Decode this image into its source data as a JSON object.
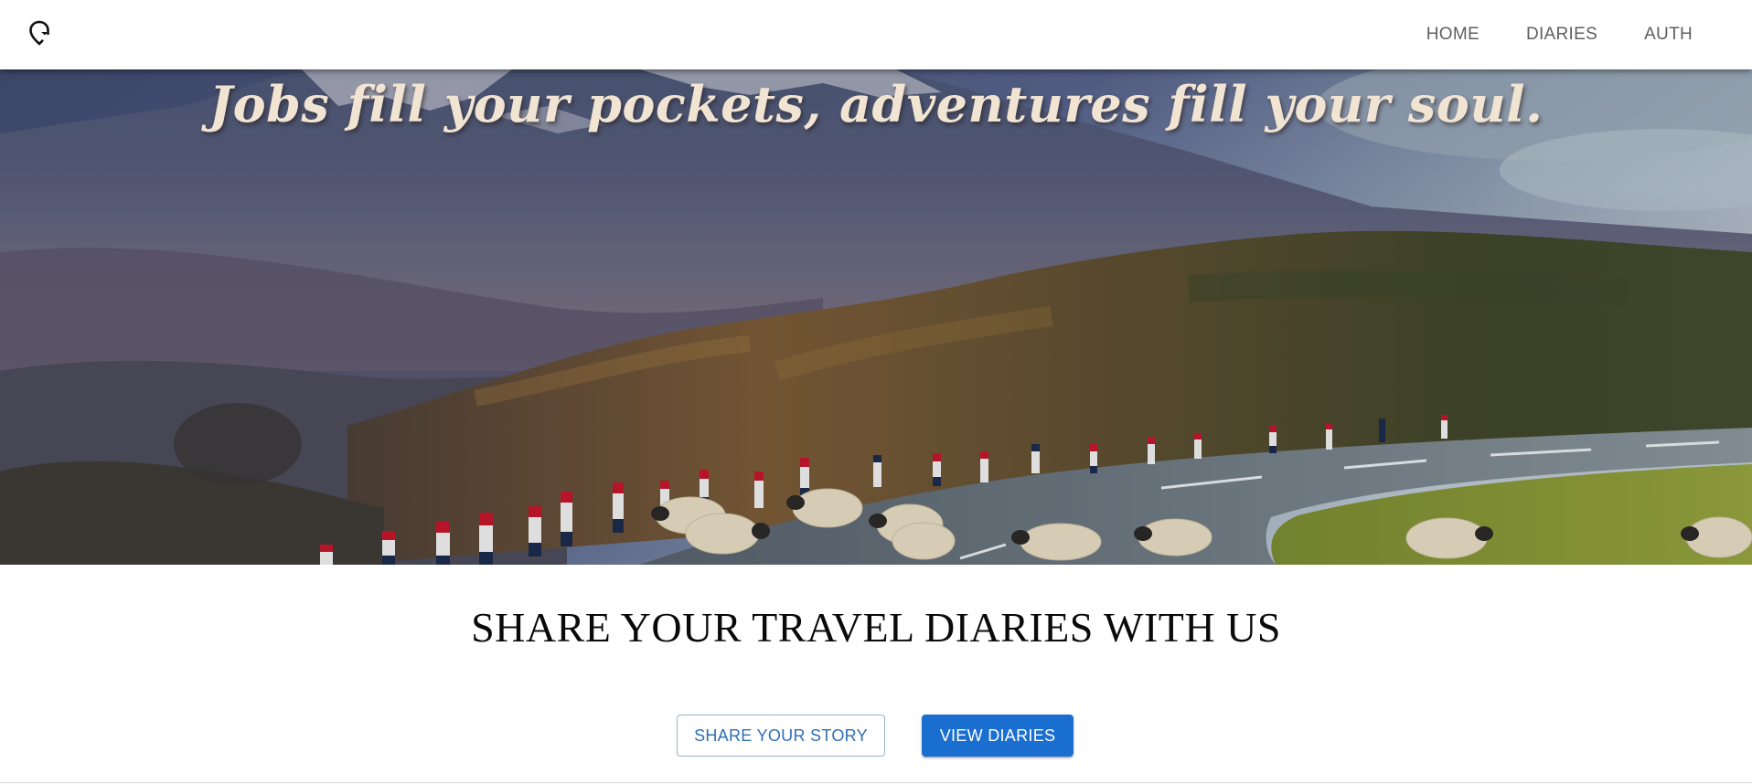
{
  "header": {
    "logo_icon": "map-pin-icon",
    "nav": [
      {
        "label": "HOME"
      },
      {
        "label": "DIARIES"
      },
      {
        "label": "AUTH"
      }
    ]
  },
  "hero": {
    "quote": "Jobs fill your pockets, adventures fill your soul.",
    "image": "mountain-road-sheep-photo"
  },
  "main": {
    "headline": "SHARE YOUR TRAVEL DIARIES WITH US",
    "share_button": "SHARE YOUR STORY",
    "view_button": "VIEW DIARIES"
  },
  "colors": {
    "primary": "#1a6ed0",
    "outline_text": "#2f6fb5",
    "nav_text": "#5f5f5f",
    "quote_text": "#f1e4d2"
  }
}
